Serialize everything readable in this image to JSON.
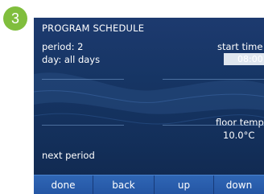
{
  "step_badge": "3",
  "screen": {
    "title": "PROGRAM SCHEDULE",
    "period": "period: 2",
    "day": "day: all days",
    "start_time_label": "start time",
    "start_time_value": "08:00",
    "floor_temp_label": "floor temp",
    "floor_temp_value": "10.0°C",
    "next_period": "next period"
  },
  "buttons": {
    "done": "done",
    "back": "back",
    "up": "up",
    "down": "down"
  },
  "colors": {
    "badge": "#80be3d",
    "screen_bg": "#163564",
    "button_bar": "#2a5cab",
    "highlight": "#dfe6ef"
  }
}
